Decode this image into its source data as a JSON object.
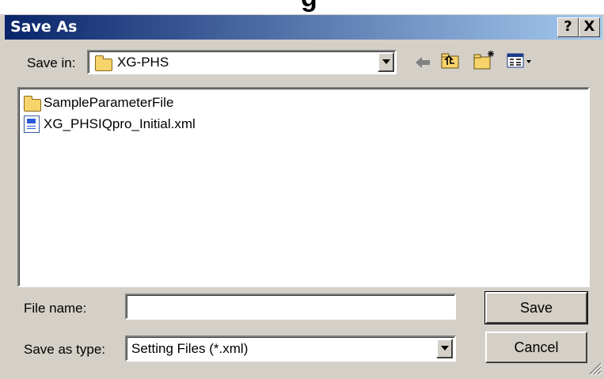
{
  "background_fragment": "g",
  "window": {
    "title": "Save As",
    "help_label": "?",
    "close_label": "X"
  },
  "save_in": {
    "label": "Save in:",
    "value": "XG-PHS"
  },
  "toolbar": {
    "back": "back-icon",
    "up": "up-folder-icon",
    "new_folder": "new-folder-icon",
    "view_menu": "view-menu-icon"
  },
  "files": [
    {
      "name": "SampleParameterFile",
      "type": "folder"
    },
    {
      "name": "XG_PHSIQpro_Initial.xml",
      "type": "xml-file"
    }
  ],
  "file_name": {
    "label": "File name:",
    "value": ""
  },
  "save_as_type": {
    "label": "Save as type:",
    "value": "Setting Files (*.xml)"
  },
  "buttons": {
    "save": "Save",
    "cancel": "Cancel"
  },
  "colors": {
    "titlebar_start": "#0a246a",
    "titlebar_end": "#a6caf0",
    "dialog_face": "#d4d0c8"
  }
}
